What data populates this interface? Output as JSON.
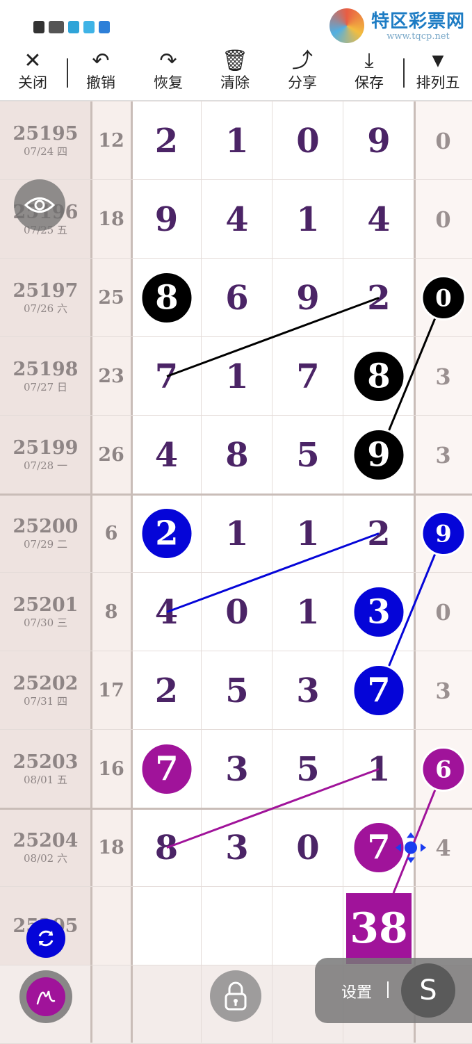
{
  "watermark": {
    "title": "特区彩票网",
    "url": "www.tqcp.net"
  },
  "toolbar": {
    "items": [
      {
        "icon": "✕",
        "label": "关闭"
      },
      {
        "icon": "↶",
        "label": "撤销"
      },
      {
        "icon": "↷",
        "label": "恢复"
      },
      {
        "icon": "🗑",
        "label": "清除"
      },
      {
        "icon": "⤴",
        "label": "分享"
      },
      {
        "icon": "⤓",
        "label": "保存"
      },
      {
        "icon": "▼",
        "label": "排列五"
      }
    ]
  },
  "rows": [
    {
      "issue": "25195",
      "date": "07/24 四",
      "sum": "12",
      "d": [
        "2",
        "1",
        "0",
        "9"
      ],
      "last": "0"
    },
    {
      "issue": "25196",
      "date": "07/25 五",
      "sum": "18",
      "d": [
        "9",
        "4",
        "1",
        "4"
      ],
      "last": "0"
    },
    {
      "issue": "25197",
      "date": "07/26 六",
      "sum": "25",
      "d": [
        "8",
        "6",
        "9",
        "2"
      ],
      "last": "0"
    },
    {
      "issue": "25198",
      "date": "07/27 日",
      "sum": "23",
      "d": [
        "7",
        "1",
        "7",
        "8"
      ],
      "last": "3"
    },
    {
      "issue": "25199",
      "date": "07/28 一",
      "sum": "26",
      "d": [
        "4",
        "8",
        "5",
        "9"
      ],
      "last": "3"
    },
    {
      "issue": "25200",
      "date": "07/29 二",
      "sum": "6",
      "d": [
        "2",
        "1",
        "1",
        "2"
      ],
      "last": "9"
    },
    {
      "issue": "25201",
      "date": "07/30 三",
      "sum": "8",
      "d": [
        "4",
        "0",
        "1",
        "3"
      ],
      "last": "0"
    },
    {
      "issue": "25202",
      "date": "07/31 四",
      "sum": "17",
      "d": [
        "2",
        "5",
        "3",
        "7"
      ],
      "last": "3"
    },
    {
      "issue": "25203",
      "date": "08/01 五",
      "sum": "16",
      "d": [
        "7",
        "3",
        "5",
        "1"
      ],
      "last": "6"
    },
    {
      "issue": "25204",
      "date": "08/02 六",
      "sum": "18",
      "d": [
        "8",
        "3",
        "0",
        "7"
      ],
      "last": "4"
    },
    {
      "issue": "25205",
      "date": "",
      "sum": "",
      "d": [
        "",
        "",
        "",
        ""
      ],
      "last": ""
    }
  ],
  "marks": {
    "colors": {
      "black": "#000000",
      "blue": "#0505d8",
      "purple": "#a0139a"
    },
    "total": "38"
  },
  "settings": {
    "label": "设置",
    "s_button": "S"
  }
}
